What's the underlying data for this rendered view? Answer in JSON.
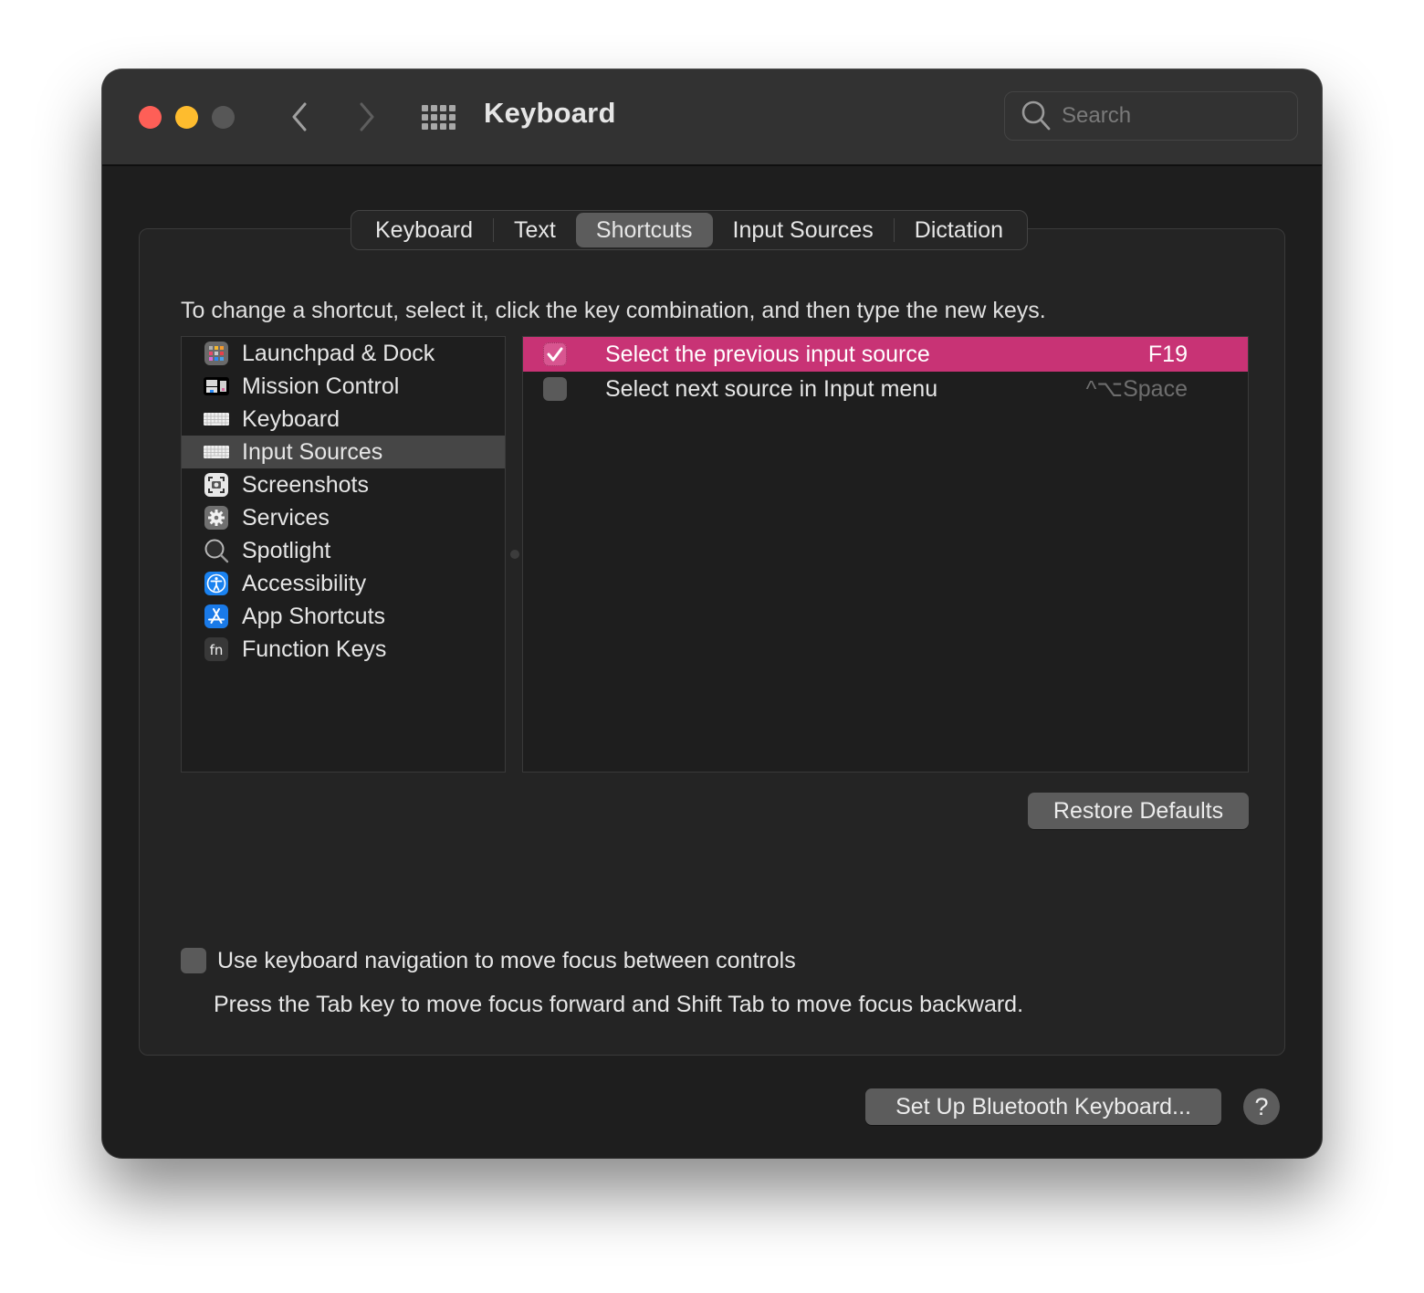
{
  "window": {
    "title": "Keyboard",
    "traffic_lights": [
      "close",
      "minimize",
      "zoom-disabled"
    ],
    "colors": {
      "close": "#fe5f57",
      "minimize": "#febc2e",
      "zoom_disabled": "#575757"
    }
  },
  "toolbar": {
    "back_icon": "chevron-left-icon",
    "forward_icon": "chevron-right-icon",
    "show_all_icon": "grid-icon",
    "search": {
      "placeholder": "Search",
      "value": ""
    }
  },
  "tabs": [
    {
      "label": "Keyboard",
      "active": false
    },
    {
      "label": "Text",
      "active": false
    },
    {
      "label": "Shortcuts",
      "active": true
    },
    {
      "label": "Input Sources",
      "active": false
    },
    {
      "label": "Dictation",
      "active": false
    }
  ],
  "shortcuts": {
    "instruction": "To change a shortcut, select it, click the key combination, and then type the new keys.",
    "categories": [
      {
        "label": "Launchpad & Dock",
        "icon": "launchpad-icon",
        "selected": false
      },
      {
        "label": "Mission Control",
        "icon": "mission-control-icon",
        "selected": false
      },
      {
        "label": "Keyboard",
        "icon": "keyboard-icon",
        "selected": false
      },
      {
        "label": "Input Sources",
        "icon": "keyboard-icon",
        "selected": true
      },
      {
        "label": "Screenshots",
        "icon": "screenshot-icon",
        "selected": false
      },
      {
        "label": "Services",
        "icon": "gear-icon",
        "selected": false
      },
      {
        "label": "Spotlight",
        "icon": "magnifier-icon",
        "selected": false
      },
      {
        "label": "Accessibility",
        "icon": "accessibility-icon",
        "selected": false
      },
      {
        "label": "App Shortcuts",
        "icon": "app-store-icon",
        "selected": false
      },
      {
        "label": "Function Keys",
        "icon": "fn-icon",
        "selected": false
      }
    ],
    "items": [
      {
        "label": "Select the previous input source",
        "key": "F19",
        "checked": true,
        "selected": true
      },
      {
        "label": "Select next source in Input menu",
        "key": "^⌥Space",
        "checked": false,
        "selected": false
      }
    ],
    "restore_defaults_label": "Restore Defaults",
    "accent_color": "#c83375"
  },
  "keyboard_navigation": {
    "checked": false,
    "label": "Use keyboard navigation to move focus between controls",
    "hint": "Press the Tab key to move focus forward and Shift Tab to move focus backward."
  },
  "footer": {
    "bluetooth_label": "Set Up Bluetooth Keyboard...",
    "help_label": "?"
  }
}
